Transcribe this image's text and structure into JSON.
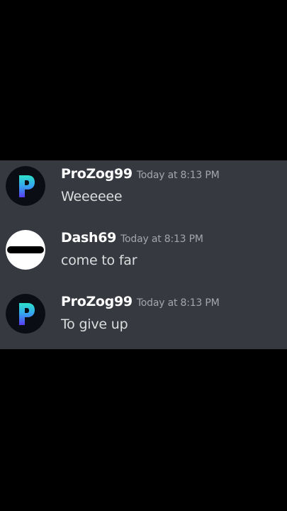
{
  "colors": {
    "background": "#000000",
    "chat_background": "#36393f",
    "username": "#ffffff",
    "timestamp": "#a3a6aa",
    "message_text": "#dcddde"
  },
  "messages": [
    {
      "author": "ProZog99",
      "timestamp": "Today at 8:13 PM",
      "text": "Weeeeee",
      "avatar_icon": "letter-p-gradient-logo"
    },
    {
      "author": "Dash69",
      "timestamp": "Today at 8:13 PM",
      "text": "come to far",
      "avatar_icon": "black-bar-on-white-circle"
    },
    {
      "author": "ProZog99",
      "timestamp": "Today at 8:13 PM",
      "text": "To give up",
      "avatar_icon": "letter-p-gradient-logo"
    }
  ]
}
